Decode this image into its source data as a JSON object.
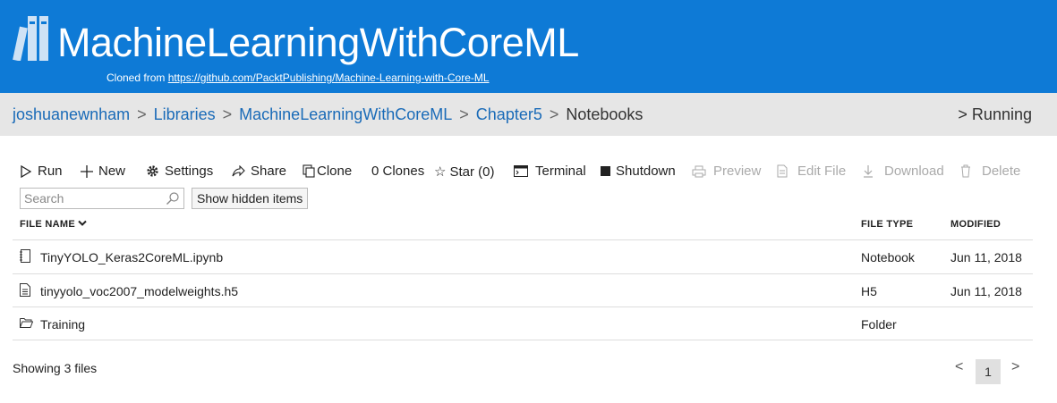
{
  "header": {
    "title": "MachineLearningWithCoreML",
    "cloned_prefix": "Cloned from ",
    "cloned_url": "https://github.com/PacktPublishing/Machine-Learning-with-Core-ML",
    "logo_icon": "books-icon",
    "brand_color": "#0e7ad6"
  },
  "breadcrumb": {
    "items": [
      "joshuanewnham",
      "Libraries",
      "MachineLearningWithCoreML",
      "Chapter5"
    ],
    "current": "Notebooks",
    "separator": ">",
    "running": "> Running"
  },
  "toolbar": {
    "run": "Run",
    "new": "New",
    "settings": "Settings",
    "share": "Share",
    "clone": "Clone",
    "clones": "0 Clones",
    "star": "Star (0)",
    "terminal": "Terminal",
    "shutdown": "Shutdown",
    "preview": "Preview",
    "edit_file": "Edit File",
    "download": "Download",
    "delete": "Delete"
  },
  "search": {
    "placeholder": "Search"
  },
  "show_hidden": "Show hidden items",
  "table": {
    "columns": {
      "name": "FILE NAME",
      "type": "FILE TYPE",
      "modified": "MODIFIED"
    },
    "rows": [
      {
        "icon": "notebook-icon",
        "name": "TinyYOLO_Keras2CoreML.ipynb",
        "type": "Notebook",
        "modified": "Jun 11, 2018"
      },
      {
        "icon": "file-icon",
        "name": "tinyyolo_voc2007_modelweights.h5",
        "type": "H5",
        "modified": "Jun 11, 2018"
      },
      {
        "icon": "folder-icon",
        "name": "Training",
        "type": "Folder",
        "modified": ""
      }
    ]
  },
  "status": "Showing 3 files",
  "pager": {
    "prev": "<",
    "current": "1",
    "next": ">"
  }
}
